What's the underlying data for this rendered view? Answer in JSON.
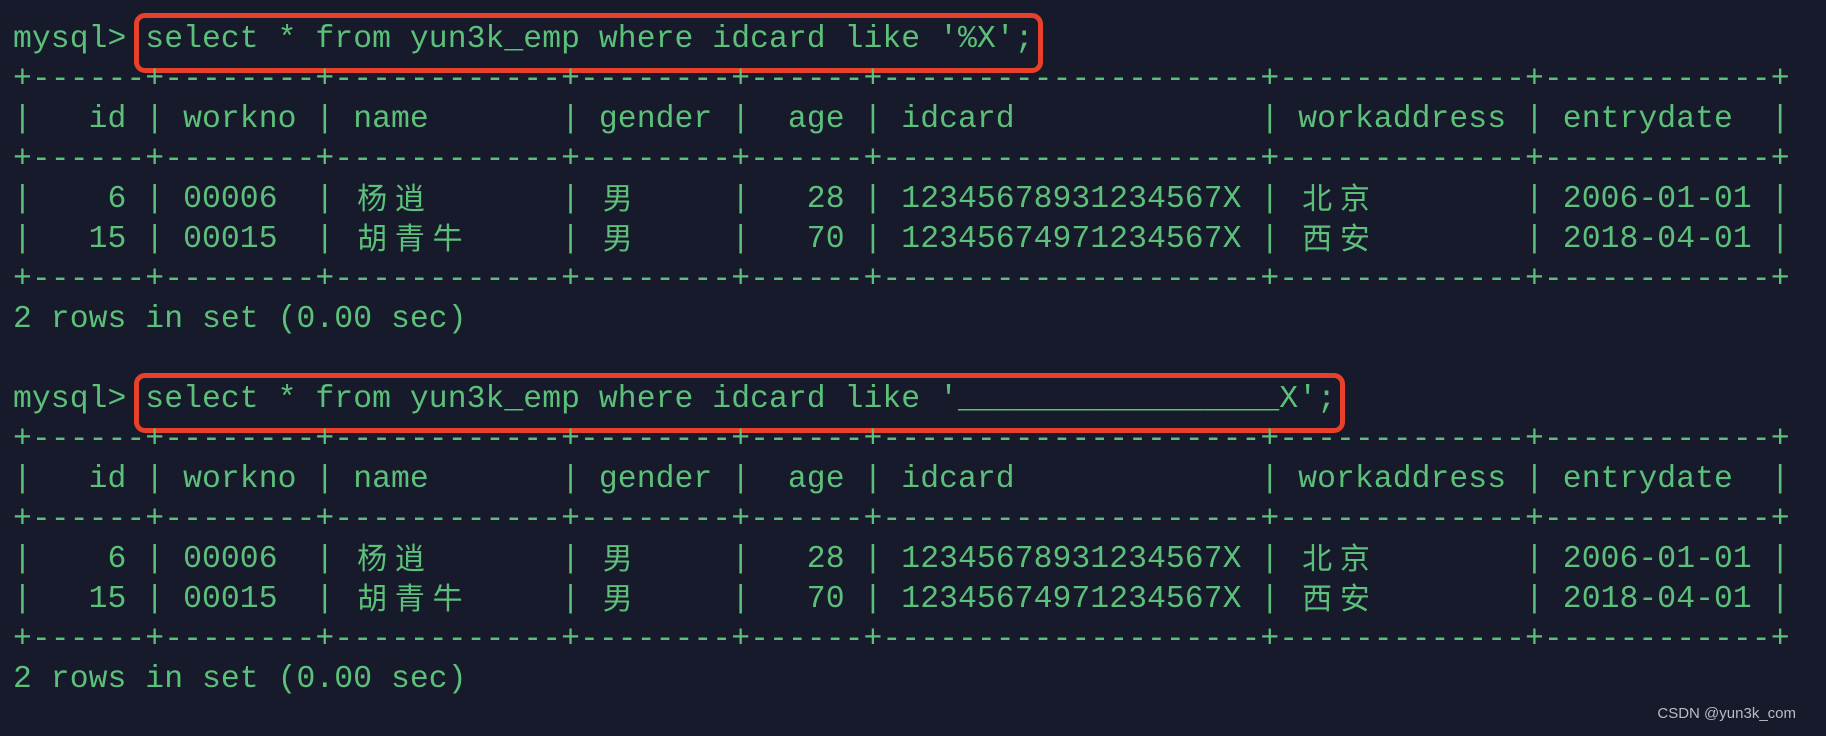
{
  "terminal": {
    "prompt": "mysql> ",
    "blocks": [
      {
        "query": "select * from yun3k_emp where idcard like '%X';",
        "highlighted": true,
        "result": {
          "columns": [
            "id",
            "workno",
            "name",
            "gender",
            "age",
            "idcard",
            "workaddress",
            "entrydate"
          ],
          "rows": [
            [
              "6",
              "00006",
              "杨逍",
              "男",
              "28",
              "12345678931234567X",
              "北京",
              "2006-01-01"
            ],
            [
              "15",
              "00015",
              "胡青牛",
              "男",
              "70",
              "12345674971234567X",
              "西安",
              "2018-04-01"
            ]
          ],
          "footer": "2 rows in set (0.00 sec)"
        }
      },
      {
        "query": "select * from yun3k_emp where idcard like '_________________X';",
        "highlighted": true,
        "result": {
          "columns": [
            "id",
            "workno",
            "name",
            "gender",
            "age",
            "idcard",
            "workaddress",
            "entrydate"
          ],
          "rows": [
            [
              "6",
              "00006",
              "杨逍",
              "男",
              "28",
              "12345678931234567X",
              "北京",
              "2006-01-01"
            ],
            [
              "15",
              "00015",
              "胡青牛",
              "男",
              "70",
              "12345674971234567X",
              "西安",
              "2018-04-01"
            ]
          ],
          "footer": "2 rows in set (0.00 sec)"
        }
      }
    ]
  },
  "watermark": "CSDN @yun3k_com",
  "colors": {
    "background": "#161a2a",
    "text": "#5cc07a",
    "highlight": "#e8402a"
  }
}
